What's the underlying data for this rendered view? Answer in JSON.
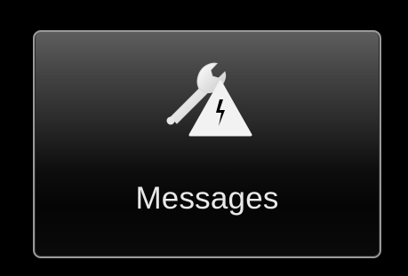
{
  "tile": {
    "label": "Messages",
    "icon": "wrench-warning-icon"
  },
  "colors": {
    "background": "#000000",
    "tile_border": "#9a9a9a",
    "text": "#e9e9e9",
    "icon": "#f0f0f0"
  }
}
